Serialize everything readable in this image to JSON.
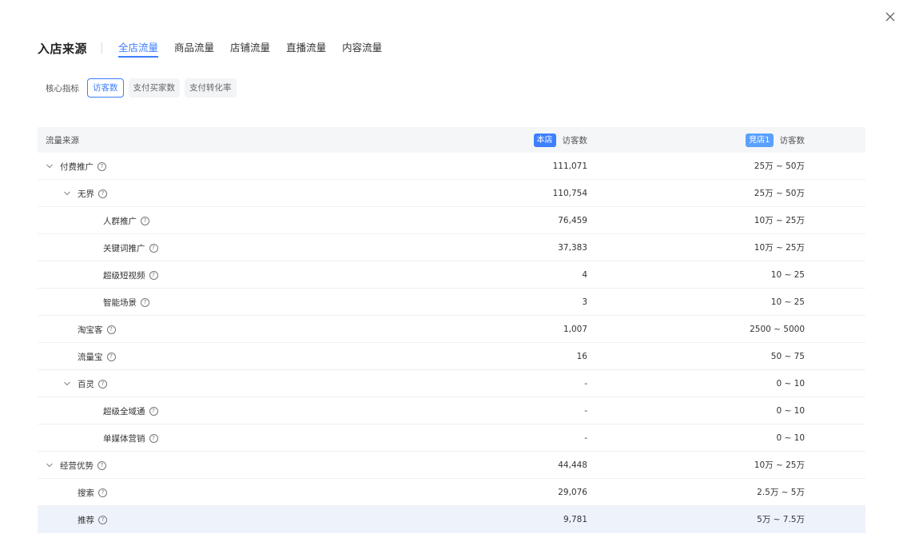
{
  "close_icon": "close-icon",
  "header": {
    "title": "入店来源",
    "tabs": [
      {
        "label": "全店流量",
        "active": true
      },
      {
        "label": "商品流量",
        "active": false
      },
      {
        "label": "店铺流量",
        "active": false
      },
      {
        "label": "直播流量",
        "active": false
      },
      {
        "label": "内容流量",
        "active": false
      }
    ]
  },
  "metrics": {
    "label": "核心指标",
    "chips": [
      {
        "label": "访客数",
        "active": true
      },
      {
        "label": "支付买家数",
        "active": false
      },
      {
        "label": "支付转化率",
        "active": false
      }
    ]
  },
  "table": {
    "col_source": "流量来源",
    "shop_tag": "本店",
    "shop_metric": "访客数",
    "comp_tag": "竞店1",
    "comp_metric": "访客数",
    "accent_color": "#3d7fff",
    "rows": [
      {
        "name": "付费推广",
        "level": 0,
        "expand": true,
        "shop": "111,071",
        "comp": "25万 ~ 50万"
      },
      {
        "name": "无界",
        "level": 1,
        "expand": true,
        "shop": "110,754",
        "comp": "25万 ~ 50万"
      },
      {
        "name": "人群推广",
        "level": 2,
        "expand": false,
        "shop": "76,459",
        "comp": "10万 ~ 25万"
      },
      {
        "name": "关键词推广",
        "level": 2,
        "expand": false,
        "shop": "37,383",
        "comp": "10万 ~ 25万"
      },
      {
        "name": "超级短视频",
        "level": 2,
        "expand": false,
        "shop": "4",
        "comp": "10 ~ 25"
      },
      {
        "name": "智能场景",
        "level": 2,
        "expand": false,
        "shop": "3",
        "comp": "10 ~ 25"
      },
      {
        "name": "淘宝客",
        "level": 1,
        "expand": false,
        "shop": "1,007",
        "comp": "2500 ~ 5000"
      },
      {
        "name": "流量宝",
        "level": 1,
        "expand": false,
        "shop": "16",
        "comp": "50 ~ 75"
      },
      {
        "name": "百灵",
        "level": 1,
        "expand": true,
        "shop": "-",
        "comp": "0 ~ 10"
      },
      {
        "name": "超级全域通",
        "level": 2,
        "expand": false,
        "shop": "-",
        "comp": "0 ~ 10"
      },
      {
        "name": "单媒体营销",
        "level": 2,
        "expand": false,
        "shop": "-",
        "comp": "0 ~ 10"
      },
      {
        "name": "经营优势",
        "level": 0,
        "expand": true,
        "shop": "44,448",
        "comp": "10万 ~ 25万"
      },
      {
        "name": "搜索",
        "level": 1,
        "expand": false,
        "shop": "29,076",
        "comp": "2.5万 ~ 5万"
      },
      {
        "name": "推荐",
        "level": 1,
        "expand": false,
        "shop": "9,781",
        "comp": "5万 ~ 7.5万",
        "highlight": true
      }
    ]
  }
}
